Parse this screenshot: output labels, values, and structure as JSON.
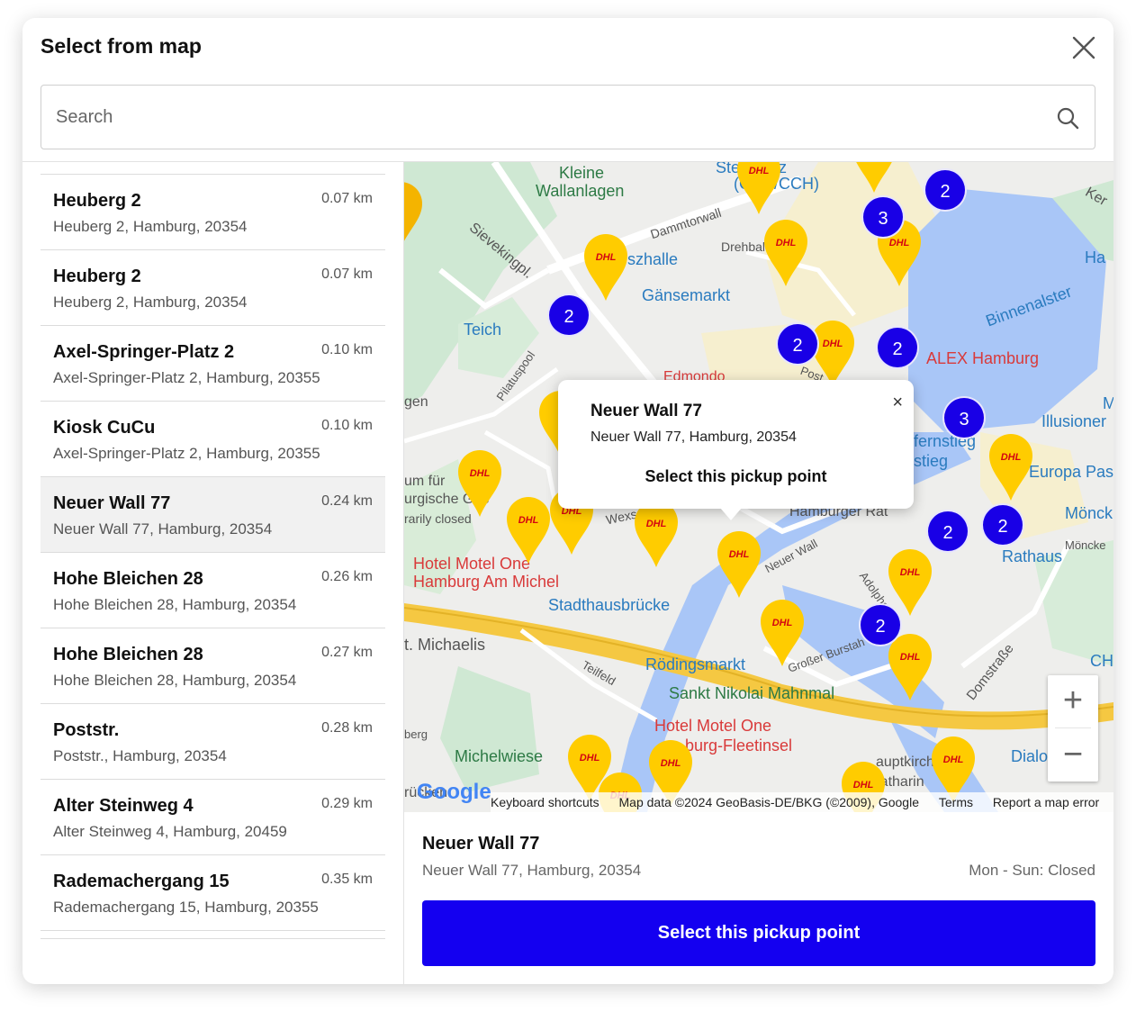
{
  "modal": {
    "title": "Select from map",
    "search_placeholder": "Search"
  },
  "list": [
    {
      "name": "Heuberg 2",
      "distance": "0.07 km",
      "address": "Heuberg 2, Hamburg, 20354"
    },
    {
      "name": "Heuberg 2",
      "distance": "0.07 km",
      "address": "Heuberg 2, Hamburg, 20354"
    },
    {
      "name": "Axel-Springer-Platz 2",
      "distance": "0.10 km",
      "address": "Axel-Springer-Platz 2, Hamburg, 20355"
    },
    {
      "name": "Kiosk CuCu",
      "distance": "0.10 km",
      "address": "Axel-Springer-Platz 2, Hamburg, 20355"
    },
    {
      "name": "Neuer Wall 77",
      "distance": "0.24 km",
      "address": "Neuer Wall 77, Hamburg, 20354"
    },
    {
      "name": "Hohe Bleichen 28",
      "distance": "0.26 km",
      "address": "Hohe Bleichen 28, Hamburg, 20354"
    },
    {
      "name": "Hohe Bleichen 28",
      "distance": "0.27 km",
      "address": "Hohe Bleichen 28, Hamburg, 20354"
    },
    {
      "name": "Poststr.",
      "distance": "0.28 km",
      "address": "Poststr., Hamburg, 20354"
    },
    {
      "name": "Alter Steinweg 4",
      "distance": "0.29 km",
      "address": "Alter Steinweg 4, Hamburg, 20459"
    },
    {
      "name": "Rademachergang 15",
      "distance": "0.35 km",
      "address": "Rademachergang 15, Hamburg, 20355"
    }
  ],
  "map": {
    "labels": {
      "kleine": "Kleine",
      "wallanlagen": "Wallanlagen",
      "dammtorwall": "Dammtorwall",
      "drehbahn": "Drehbal",
      "szhalle": "szhalle",
      "gaensemarkt": "Gänsemarkt",
      "sievekingpl": "Sievekingpl.",
      "teich": "Teich",
      "pilatuspool": "Pilatuspool",
      "binnenalster": "Binnenalster",
      "alex": "ALEX Hamburg",
      "illusion": "Illusioner",
      "europa": "Europa Pas",
      "hamburger_rat": "Hamburger Rat",
      "rathaus": "Rathaus",
      "moenck": "Mönck",
      "moencke": "Möncke",
      "hotel_michel_1": "Hotel Motel One",
      "hotel_michel_2": "Hamburg Am Michel",
      "stadthausbruecke": "Stadthausbrücke",
      "michaelis": "t. Michaelis",
      "teilfeld": "Teilfeld",
      "roedingsmarkt": "Rödingsmarkt",
      "sankt_nikolai": "Sankt Nikolai Mahnmal",
      "hotel_fleet_1": "Hotel Motel One",
      "hotel_fleet_2": "burg-Fleetinsel",
      "michelwiese": "Michelwiese",
      "hauptkirche_1": "auptkirch",
      "hauptkirche_2": "Katharin",
      "domstrasse": "Domstraße",
      "grosser_burstah": "Großer Burstah",
      "adolphspl": "Adolphspl.",
      "neuer_wall": "Neuer Wall",
      "edmondo": "Edmondo",
      "cch": "(CCH/CCH)",
      "steinplatz": "Ste      splatz",
      "rium_1": "um für",
      "rium_2": "urgische Ges",
      "rium_3": "rarily closed",
      "gen": "gen",
      "berg": "berg",
      "ruecken": "rücken",
      "dialo": "Dialo",
      "jungfernstieg_1": "fernstieg",
      "jungfernstieg_2": "stieg",
      "che": "CHE",
      "ha": "Ha",
      "ker": "Ker",
      "m": "M",
      "wex": "Wexs",
      "post": "Post"
    },
    "clusters": [
      "2",
      "3",
      "2",
      "2",
      "2",
      "3",
      "2",
      "2",
      "2"
    ],
    "popup": {
      "title": "Neuer Wall 77",
      "address": "Neuer Wall 77, Hamburg, 20354",
      "select_label": "Select this pickup point",
      "close_label": "×"
    },
    "zoom": {
      "in": "+",
      "out": "−"
    },
    "google": "Google",
    "attribution": [
      "Keyboard shortcuts",
      "Map data ©2024 GeoBasis-DE/BKG (©2009), Google",
      "Terms",
      "Report a map error"
    ],
    "pin_label": "DHL"
  },
  "details": {
    "name": "Neuer Wall 77",
    "address": "Neuer Wall 77, Hamburg, 20354",
    "hours": "Mon - Sun: Closed",
    "select_label": "Select this pickup point"
  },
  "colors": {
    "accent": "#1400f0",
    "cluster": "#1900e6",
    "pin": "#ffcc00",
    "dhl_red": "#d40511"
  }
}
